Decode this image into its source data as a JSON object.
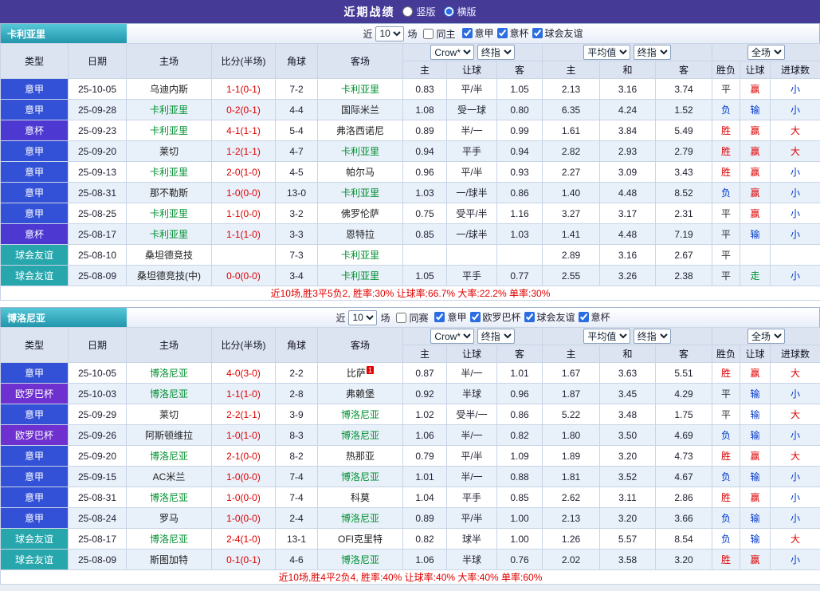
{
  "topbar": {
    "title": "近期战绩",
    "layout_options": [
      {
        "label": "竖版",
        "selected": false
      },
      {
        "label": "横版",
        "selected": true
      }
    ]
  },
  "columns": {
    "type": "类型",
    "date": "日期",
    "home": "主场",
    "score": "比分(半场)",
    "corner": "角球",
    "away": "客场",
    "odds_home": "主",
    "odds_handicap": "让球",
    "odds_away": "客",
    "avg_home": "主",
    "avg_draw": "和",
    "avg_away": "客",
    "result": "胜负",
    "handicap_result": "让球",
    "goals": "进球数"
  },
  "sections": [
    {
      "team": "卡利亚里",
      "controls": {
        "near": "近",
        "count": "10",
        "unit": "场",
        "same": {
          "label": "同主",
          "checked": false
        },
        "filters": [
          {
            "label": "意甲",
            "checked": true
          },
          {
            "label": "意杯",
            "checked": true
          },
          {
            "label": "球会友谊",
            "checked": true
          }
        ]
      },
      "dropdowns": {
        "odds_company": "Crow*",
        "odds_stage": "终指",
        "avg_source": "平均值",
        "avg_stage": "终指",
        "scope": "全场"
      },
      "rows": [
        {
          "type": "意甲",
          "date": "25-10-05",
          "home": "乌迪内斯",
          "score": "1-1(0-1)",
          "corner": "7-2",
          "away": "卡利亚里",
          "odds_home": "0.83",
          "handicap": "平/半",
          "odds_away": "1.05",
          "avg_home": "2.13",
          "avg_draw": "3.16",
          "avg_away": "3.74",
          "result": "平",
          "handicap_result": "赢",
          "goals": "小"
        },
        {
          "type": "意甲",
          "date": "25-09-28",
          "home": "卡利亚里",
          "score": "0-2(0-1)",
          "corner": "4-4",
          "away": "国际米兰",
          "odds_home": "1.08",
          "handicap": "受一球",
          "odds_away": "0.80",
          "avg_home": "6.35",
          "avg_draw": "4.24",
          "avg_away": "1.52",
          "result": "负",
          "handicap_result": "输",
          "goals": "小"
        },
        {
          "type": "意杯",
          "date": "25-09-23",
          "home": "卡利亚里",
          "score": "4-1(1-1)",
          "corner": "5-4",
          "away": "弗洛西诺尼",
          "odds_home": "0.89",
          "handicap": "半/一",
          "odds_away": "0.99",
          "avg_home": "1.61",
          "avg_draw": "3.84",
          "avg_away": "5.49",
          "result": "胜",
          "handicap_result": "赢",
          "goals": "大"
        },
        {
          "type": "意甲",
          "date": "25-09-20",
          "home": "莱切",
          "score": "1-2(1-1)",
          "corner": "4-7",
          "away": "卡利亚里",
          "odds_home": "0.94",
          "handicap": "平手",
          "odds_away": "0.94",
          "avg_home": "2.82",
          "avg_draw": "2.93",
          "avg_away": "2.79",
          "result": "胜",
          "handicap_result": "赢",
          "goals": "大"
        },
        {
          "type": "意甲",
          "date": "25-09-13",
          "home": "卡利亚里",
          "score": "2-0(1-0)",
          "corner": "4-5",
          "away": "帕尔马",
          "odds_home": "0.96",
          "handicap": "平/半",
          "odds_away": "0.93",
          "avg_home": "2.27",
          "avg_draw": "3.09",
          "avg_away": "3.43",
          "result": "胜",
          "handicap_result": "赢",
          "goals": "小"
        },
        {
          "type": "意甲",
          "date": "25-08-31",
          "home": "那不勒斯",
          "score": "1-0(0-0)",
          "corner": "13-0",
          "away": "卡利亚里",
          "odds_home": "1.03",
          "handicap": "一/球半",
          "odds_away": "0.86",
          "avg_home": "1.40",
          "avg_draw": "4.48",
          "avg_away": "8.52",
          "result": "负",
          "handicap_result": "赢",
          "goals": "小"
        },
        {
          "type": "意甲",
          "date": "25-08-25",
          "home": "卡利亚里",
          "score": "1-1(0-0)",
          "corner": "3-2",
          "away": "佛罗伦萨",
          "odds_home": "0.75",
          "handicap": "受平/半",
          "odds_away": "1.16",
          "avg_home": "3.27",
          "avg_draw": "3.17",
          "avg_away": "2.31",
          "result": "平",
          "handicap_result": "赢",
          "goals": "小"
        },
        {
          "type": "意杯",
          "date": "25-08-17",
          "home": "卡利亚里",
          "score": "1-1(1-0)",
          "corner": "3-3",
          "away": "恩特拉",
          "odds_home": "0.85",
          "handicap": "一/球半",
          "odds_away": "1.03",
          "avg_home": "1.41",
          "avg_draw": "4.48",
          "avg_away": "7.19",
          "result": "平",
          "handicap_result": "输",
          "goals": "小"
        },
        {
          "type": "球会友谊",
          "date": "25-08-10",
          "home": "桑坦德竞技",
          "score": "",
          "corner": "7-3",
          "away": "卡利亚里",
          "odds_home": "",
          "handicap": "",
          "odds_away": "",
          "avg_home": "2.89",
          "avg_draw": "3.16",
          "avg_away": "2.67",
          "result": "平",
          "handicap_result": "",
          "goals": ""
        },
        {
          "type": "球会友谊",
          "date": "25-08-09",
          "home": "桑坦德竞技(中)",
          "score": "0-0(0-0)",
          "corner": "3-4",
          "away": "卡利亚里",
          "odds_home": "1.05",
          "handicap": "平手",
          "odds_away": "0.77",
          "avg_home": "2.55",
          "avg_draw": "3.26",
          "avg_away": "2.38",
          "result": "平",
          "handicap_result": "走",
          "goals": "小"
        }
      ],
      "summary": "近10场,胜3平5负2, 胜率:30% 让球率:66.7% 大率:22.2% 单率:30%"
    },
    {
      "team": "博洛尼亚",
      "controls": {
        "near": "近",
        "count": "10",
        "unit": "场",
        "same": {
          "label": "同赛",
          "checked": false
        },
        "filters": [
          {
            "label": "意甲",
            "checked": true
          },
          {
            "label": "欧罗巴杯",
            "checked": true
          },
          {
            "label": "球会友谊",
            "checked": true
          },
          {
            "label": "意杯",
            "checked": true
          }
        ]
      },
      "dropdowns": {
        "odds_company": "Crow*",
        "odds_stage": "终指",
        "avg_source": "平均值",
        "avg_stage": "终指",
        "scope": "全场"
      },
      "rows": [
        {
          "type": "意甲",
          "date": "25-10-05",
          "home": "博洛尼亚",
          "score": "4-0(3-0)",
          "corner": "2-2",
          "away": "比萨",
          "away_sup": "1",
          "odds_home": "0.87",
          "handicap": "半/一",
          "odds_away": "1.01",
          "avg_home": "1.67",
          "avg_draw": "3.63",
          "avg_away": "5.51",
          "result": "胜",
          "handicap_result": "赢",
          "goals": "大"
        },
        {
          "type": "欧罗巴杯",
          "date": "25-10-03",
          "home": "博洛尼亚",
          "score": "1-1(1-0)",
          "corner": "2-8",
          "away": "弗赖堡",
          "odds_home": "0.92",
          "handicap": "半球",
          "odds_away": "0.96",
          "avg_home": "1.87",
          "avg_draw": "3.45",
          "avg_away": "4.29",
          "result": "平",
          "handicap_result": "输",
          "goals": "小"
        },
        {
          "type": "意甲",
          "date": "25-09-29",
          "home": "莱切",
          "score": "2-2(1-1)",
          "corner": "3-9",
          "away": "博洛尼亚",
          "odds_home": "1.02",
          "handicap": "受半/一",
          "odds_away": "0.86",
          "avg_home": "5.22",
          "avg_draw": "3.48",
          "avg_away": "1.75",
          "result": "平",
          "handicap_result": "输",
          "goals": "大"
        },
        {
          "type": "欧罗巴杯",
          "date": "25-09-26",
          "home": "阿斯顿维拉",
          "score": "1-0(1-0)",
          "corner": "8-3",
          "away": "博洛尼亚",
          "odds_home": "1.06",
          "handicap": "半/一",
          "odds_away": "0.82",
          "avg_home": "1.80",
          "avg_draw": "3.50",
          "avg_away": "4.69",
          "result": "负",
          "handicap_result": "输",
          "goals": "小"
        },
        {
          "type": "意甲",
          "date": "25-09-20",
          "home": "博洛尼亚",
          "score": "2-1(0-0)",
          "corner": "8-2",
          "away": "热那亚",
          "odds_home": "0.79",
          "handicap": "平/半",
          "odds_away": "1.09",
          "avg_home": "1.89",
          "avg_draw": "3.20",
          "avg_away": "4.73",
          "result": "胜",
          "handicap_result": "赢",
          "goals": "大"
        },
        {
          "type": "意甲",
          "date": "25-09-15",
          "home": "AC米兰",
          "score": "1-0(0-0)",
          "corner": "7-4",
          "away": "博洛尼亚",
          "odds_home": "1.01",
          "handicap": "半/一",
          "odds_away": "0.88",
          "avg_home": "1.81",
          "avg_draw": "3.52",
          "avg_away": "4.67",
          "result": "负",
          "handicap_result": "输",
          "goals": "小"
        },
        {
          "type": "意甲",
          "date": "25-08-31",
          "home": "博洛尼亚",
          "score": "1-0(0-0)",
          "corner": "7-4",
          "away": "科莫",
          "odds_home": "1.04",
          "handicap": "平手",
          "odds_away": "0.85",
          "avg_home": "2.62",
          "avg_draw": "3.11",
          "avg_away": "2.86",
          "result": "胜",
          "handicap_result": "赢",
          "goals": "小"
        },
        {
          "type": "意甲",
          "date": "25-08-24",
          "home": "罗马",
          "score": "1-0(0-0)",
          "corner": "2-4",
          "away": "博洛尼亚",
          "odds_home": "0.89",
          "handicap": "平/半",
          "odds_away": "1.00",
          "avg_home": "2.13",
          "avg_draw": "3.20",
          "avg_away": "3.66",
          "result": "负",
          "handicap_result": "输",
          "goals": "小"
        },
        {
          "type": "球会友谊",
          "date": "25-08-17",
          "home": "博洛尼亚",
          "score": "2-4(1-0)",
          "corner": "13-1",
          "away": "OFI克里特",
          "odds_home": "0.82",
          "handicap": "球半",
          "odds_away": "1.00",
          "avg_home": "1.26",
          "avg_draw": "5.57",
          "avg_away": "8.54",
          "result": "负",
          "handicap_result": "输",
          "goals": "大"
        },
        {
          "type": "球会友谊",
          "date": "25-08-09",
          "home": "斯图加特",
          "score": "0-1(0-1)",
          "corner": "4-6",
          "away": "博洛尼亚",
          "odds_home": "1.06",
          "handicap": "半球",
          "odds_away": "0.76",
          "avg_home": "2.02",
          "avg_draw": "3.58",
          "avg_away": "3.20",
          "result": "胜",
          "handicap_result": "赢",
          "goals": "小"
        }
      ],
      "summary": "近10场,胜4平2负4, 胜率:40% 让球率:40% 大率:40% 单率:60%"
    }
  ]
}
